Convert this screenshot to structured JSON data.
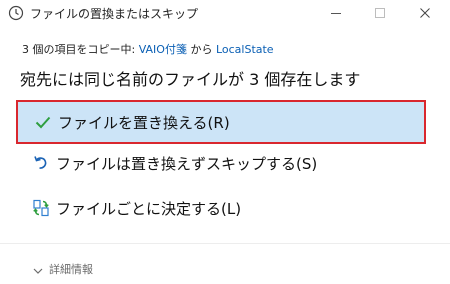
{
  "window": {
    "title": "ファイルの置換またはスキップ",
    "controls": {
      "minimize": "minimize",
      "maximize": "maximize",
      "close": "close"
    }
  },
  "copy_status": {
    "prefix": "3 個の項目をコピー中: ",
    "source": "VAIO付箋",
    "middle": " から ",
    "destination": "LocalState"
  },
  "heading": "宛先には同じ名前のファイルが 3 個存在します",
  "options": [
    {
      "label": "ファイルを置き換える(R)",
      "icon": "checkmark-icon",
      "selected": true
    },
    {
      "label": "ファイルは置き換えずスキップする(S)",
      "icon": "skip-arrow-icon",
      "selected": false
    },
    {
      "label": "ファイルごとに決定する(L)",
      "icon": "decide-files-icon",
      "selected": false
    }
  ],
  "details": {
    "label": "詳細情報",
    "icon": "chevron-down-icon"
  },
  "colors": {
    "accent": "#0a5fb4",
    "selected_bg": "#cce4f7",
    "highlight_border": "#d9272e",
    "check_green": "#2e9e3f"
  }
}
